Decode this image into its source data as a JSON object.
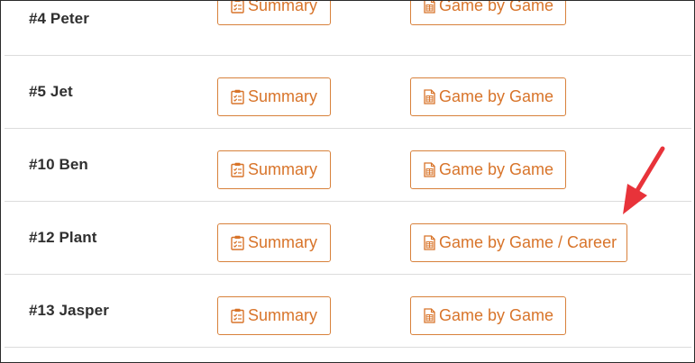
{
  "players": [
    {
      "name": "#4 Peter",
      "summary_label": "Summary",
      "detail_label": "Game by Game"
    },
    {
      "name": "#5 Jet",
      "summary_label": "Summary",
      "detail_label": "Game by Game"
    },
    {
      "name": "#10 Ben",
      "summary_label": "Summary",
      "detail_label": "Game by Game"
    },
    {
      "name": "#12 Plant",
      "summary_label": "Summary",
      "detail_label": "Game by Game / Career"
    },
    {
      "name": "#13 Jasper",
      "summary_label": "Summary",
      "detail_label": "Game by Game"
    }
  ],
  "icons": {
    "summary": "clipboard-checklist-icon",
    "detail": "spreadsheet-document-icon",
    "annotation": "red-arrow-icon"
  },
  "colors": {
    "accent": "#d8742a",
    "annotation": "#e8333a",
    "divider": "#dcdcdc"
  }
}
